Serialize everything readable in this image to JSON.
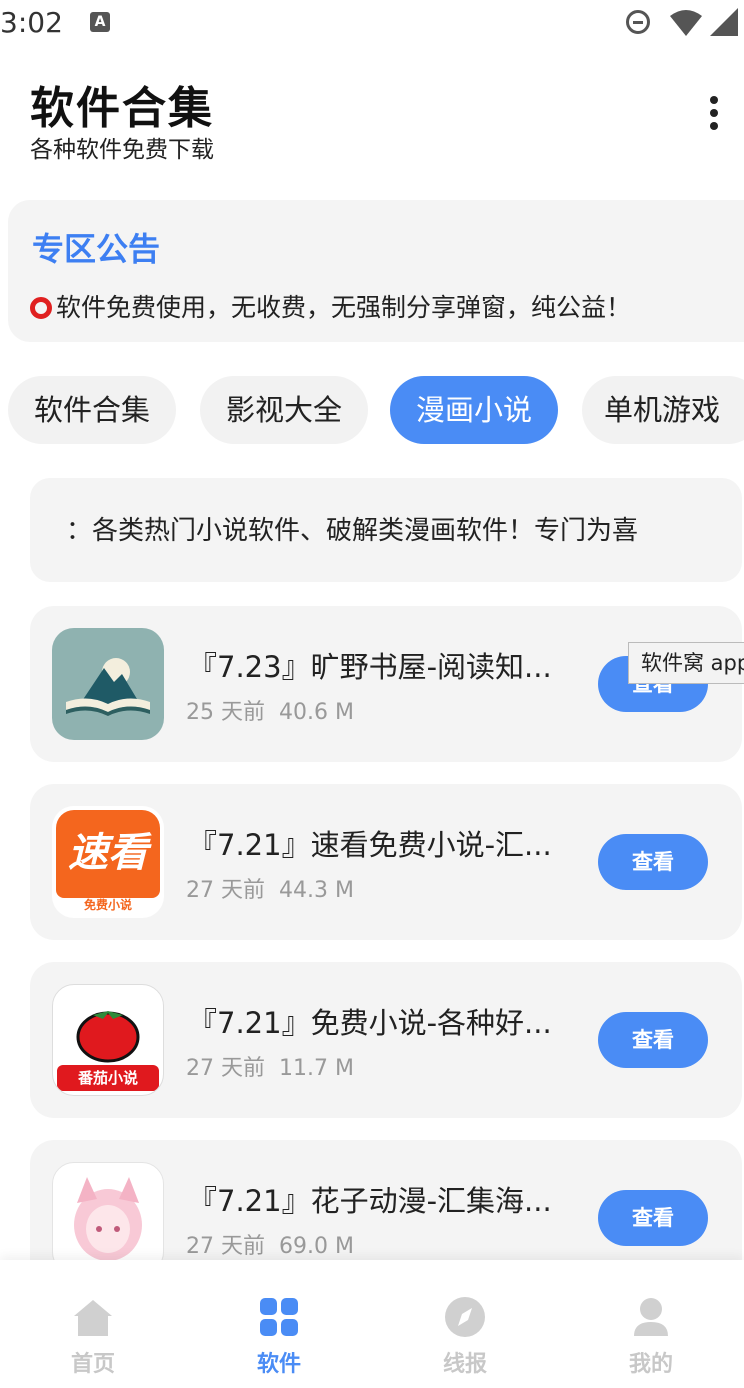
{
  "status_bar": {
    "time": "3:02",
    "notification_icon": "A"
  },
  "header": {
    "title": "软件合集",
    "subtitle": "各种软件免费下载",
    "more_icon": "more-vertical-icon"
  },
  "notice": {
    "title": "专区公告",
    "text": "软件免费使用，无收费，无强制分享弹窗，纯公益！",
    "bullet_color": "#e02020"
  },
  "tabs": [
    {
      "label": "软件合集",
      "active": false
    },
    {
      "label": "影视大全",
      "active": false
    },
    {
      "label": "漫画小说",
      "active": true
    },
    {
      "label": "单机游戏",
      "active": false
    }
  ],
  "marquee": {
    "text": "：各类热门小说软件、破解类漫画软件！专门为喜"
  },
  "apps": [
    {
      "title": "『7.23』旷野书屋-阅读知...",
      "age": "25 天前",
      "size": "40.6 M",
      "button": "查看",
      "icon": "book-mountain-icon"
    },
    {
      "title": "『7.21』速看免费小说-汇...",
      "age": "27 天前",
      "size": "44.3 M",
      "button": "查看",
      "icon": "sukan-logo-icon",
      "icon_text": "速看",
      "icon_subtext": "免费小说"
    },
    {
      "title": "『7.21』免费小说-各种好...",
      "age": "27 天前",
      "size": "11.7 M",
      "button": "查看",
      "icon": "tomato-icon",
      "icon_subtext": "番茄小说"
    },
    {
      "title": "『7.21』花子动漫-汇集海...",
      "age": "27 天前",
      "size": "69.0 M",
      "button": "查看",
      "icon": "anime-girl-icon"
    }
  ],
  "tooltip": {
    "text": "软件窝 app"
  },
  "bottom_nav": [
    {
      "label": "首页",
      "icon": "home-icon",
      "active": false
    },
    {
      "label": "软件",
      "icon": "grid-icon",
      "active": true
    },
    {
      "label": "线报",
      "icon": "compass-icon",
      "active": false
    },
    {
      "label": "我的",
      "icon": "user-icon",
      "active": false
    }
  ],
  "colors": {
    "accent": "#4a8cf5",
    "card_bg": "#f4f4f4",
    "muted": "#999999"
  }
}
